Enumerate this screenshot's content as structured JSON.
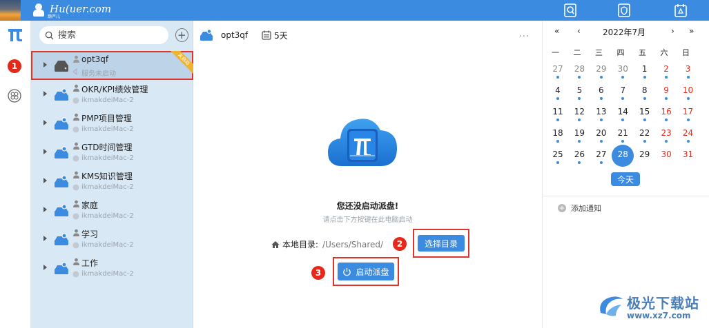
{
  "topbar": {
    "brand_name": "Hu(uer.com",
    "brand_sub": "葫芦儿"
  },
  "rail": {
    "annotation_1": "1"
  },
  "projects": {
    "search_placeholder": "搜索",
    "items": [
      {
        "name": "opt3qf",
        "status": "服务未启动",
        "ribbon": "未启动"
      },
      {
        "name": "OKR/KPI绩效管理",
        "status": "ikmakdeiMac-2"
      },
      {
        "name": "PMP项目管理",
        "status": "ikmakdeiMac-2"
      },
      {
        "name": "GTD时间管理",
        "status": "ikmakdeiMac-2"
      },
      {
        "name": "KMS知识管理",
        "status": "ikmakdeiMac-2"
      },
      {
        "name": "家庭",
        "status": "ikmakdeiMac-2"
      },
      {
        "name": "学习",
        "status": "ikmakdeiMac-2"
      },
      {
        "name": "工作",
        "status": "ikmakdeiMac-2"
      }
    ]
  },
  "main": {
    "title": "opt3qf",
    "days": "5天",
    "more": "...",
    "empty_title": "您还没启动派盘!",
    "empty_hint": "请点击下方按键在此电脑启动",
    "dir_label": "本地目录:",
    "dir_path": "/Users/Shared/",
    "choose_label": "选择目录",
    "start_label": "启动派盘",
    "annotation_2": "2",
    "annotation_3": "3"
  },
  "calendar": {
    "prev_year": "«",
    "prev_month": "‹",
    "month": "2022年7月",
    "next_month": "›",
    "next_year": "»",
    "weekdays": [
      "一",
      "二",
      "三",
      "四",
      "五",
      "六",
      "日"
    ],
    "rows": [
      [
        {
          "d": "27",
          "c": "grey",
          "dot": true
        },
        {
          "d": "28",
          "c": "grey",
          "dot": true
        },
        {
          "d": "29",
          "c": "grey",
          "dot": true
        },
        {
          "d": "30",
          "c": "grey",
          "dot": true
        },
        {
          "d": "1",
          "c": "",
          "dot": true
        },
        {
          "d": "2",
          "c": "red",
          "dot": true
        },
        {
          "d": "3",
          "c": "red",
          "dot": true
        }
      ],
      [
        {
          "d": "4",
          "c": "",
          "dot": true
        },
        {
          "d": "5",
          "c": "",
          "dot": true
        },
        {
          "d": "6",
          "c": "",
          "dot": true
        },
        {
          "d": "7",
          "c": "",
          "dot": true
        },
        {
          "d": "8",
          "c": "",
          "dot": true
        },
        {
          "d": "9",
          "c": "red",
          "dot": true
        },
        {
          "d": "10",
          "c": "red",
          "dot": true
        }
      ],
      [
        {
          "d": "11",
          "c": "",
          "dot": true
        },
        {
          "d": "12",
          "c": "",
          "dot": true
        },
        {
          "d": "13",
          "c": "",
          "dot": true
        },
        {
          "d": "14",
          "c": "",
          "dot": true
        },
        {
          "d": "15",
          "c": "",
          "dot": true
        },
        {
          "d": "16",
          "c": "red",
          "dot": true
        },
        {
          "d": "17",
          "c": "red",
          "dot": true
        }
      ],
      [
        {
          "d": "18",
          "c": "",
          "dot": true
        },
        {
          "d": "19",
          "c": "",
          "dot": true
        },
        {
          "d": "20",
          "c": "",
          "dot": true
        },
        {
          "d": "21",
          "c": "",
          "dot": true
        },
        {
          "d": "22",
          "c": "",
          "dot": true
        },
        {
          "d": "23",
          "c": "red",
          "dot": true
        },
        {
          "d": "24",
          "c": "red",
          "dot": true
        }
      ],
      [
        {
          "d": "25",
          "c": "",
          "dot": true
        },
        {
          "d": "26",
          "c": "",
          "dot": true
        },
        {
          "d": "27",
          "c": "",
          "dot": true
        },
        {
          "d": "28",
          "c": "today",
          "dot": false
        },
        {
          "d": "29",
          "c": "",
          "dot": false
        },
        {
          "d": "30",
          "c": "red",
          "dot": false
        },
        {
          "d": "31",
          "c": "red",
          "dot": false
        }
      ]
    ],
    "today_label": "今天",
    "add_note": "添加通知"
  },
  "watermark": {
    "title": "极光下载站",
    "url": "www.xz7.com"
  },
  "colors": {
    "accent": "#3b8be0",
    "annotation_red": "#e5281a",
    "list_bg": "#d9e8f5"
  }
}
